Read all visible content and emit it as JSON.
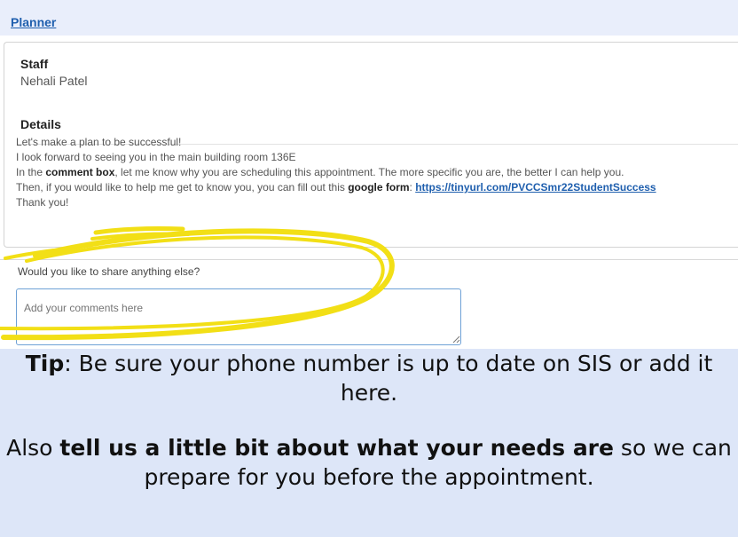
{
  "nav": {
    "link": "Planner"
  },
  "staff": {
    "heading": "Staff",
    "name": "Nehali Patel"
  },
  "details": {
    "heading": "Details",
    "line1": "Let's make a plan to be successful!",
    "line2": "I look forward to seeing you in the main building room 136E",
    "line3_pre": "In the ",
    "line3_bold": "comment box",
    "line3_post": ", let me know why you are scheduling this appointment.  The more specific you are, the better I can help you.",
    "line4_pre": "Then, if you would like to help me get to know you, you can fill out this ",
    "line4_bold": "google form",
    "line4_sep": ": ",
    "line4_link": "https://tinyurl.com/PVCCSmr22StudentSuccess",
    "line5": "Thank you!"
  },
  "question": {
    "label": "Would you like to share anything else?",
    "placeholder": "Add your comments here"
  },
  "tip": {
    "tip_bold": "Tip",
    "tip_text": ": Be sure your phone number is up to date on SIS or add it here.",
    "also_pre": "Also ",
    "also_bold": "tell us a little bit about what your needs are",
    "also_post": " so we can prepare for you before the appointment."
  },
  "colors": {
    "highlight": "#f2df16",
    "link": "#1f5fae",
    "footer_bg": "#dde6f8"
  }
}
